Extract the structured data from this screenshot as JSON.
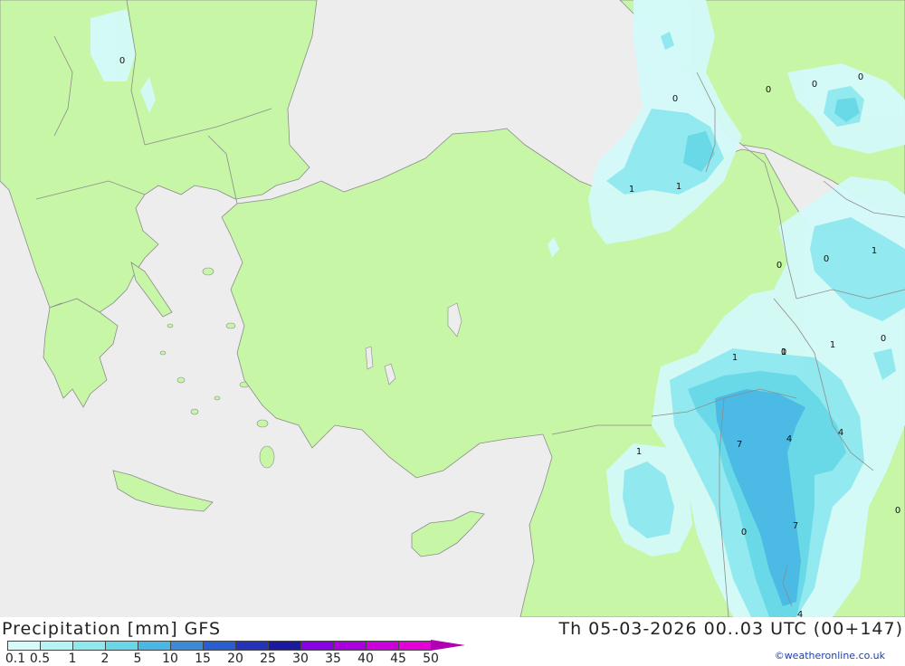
{
  "legend": {
    "title": "Precipitation [mm] GFS",
    "datetime": "Th 05-03-2026 00..03 UTC (00+147)",
    "credit": "©weatheronline.co.uk",
    "scale_labels": [
      "0.1",
      "0.5",
      "1",
      "2",
      "5",
      "10",
      "15",
      "20",
      "25",
      "30",
      "35",
      "40",
      "45",
      "50"
    ],
    "scale_colors": [
      "#d4fafa",
      "#b4f4f4",
      "#8ee8ee",
      "#68d8e6",
      "#4ab8e4",
      "#3a8ad8",
      "#2a5ed0",
      "#2434b8",
      "#1a1aa0",
      "#8800e8",
      "#aa00e0",
      "#cc00dc",
      "#e400d8",
      "#b000b0"
    ]
  },
  "colors": {
    "sea": "#ededed",
    "land": "#c6f6a6",
    "precip_0": "#d4fafa",
    "precip_1": "#8ee8ee",
    "precip_2": "#68d8e6",
    "precip_5": "#4ab8e4",
    "precip_10": "#3a8ad8",
    "border": "#8c8c8c"
  },
  "map_values": [
    "0",
    "0",
    "0",
    "0",
    "0",
    "1",
    "1",
    "0",
    "0",
    "1",
    "1",
    "0",
    "1",
    "0",
    "1",
    "7",
    "4",
    "4",
    "1",
    "0",
    "7",
    "0",
    "4"
  ]
}
